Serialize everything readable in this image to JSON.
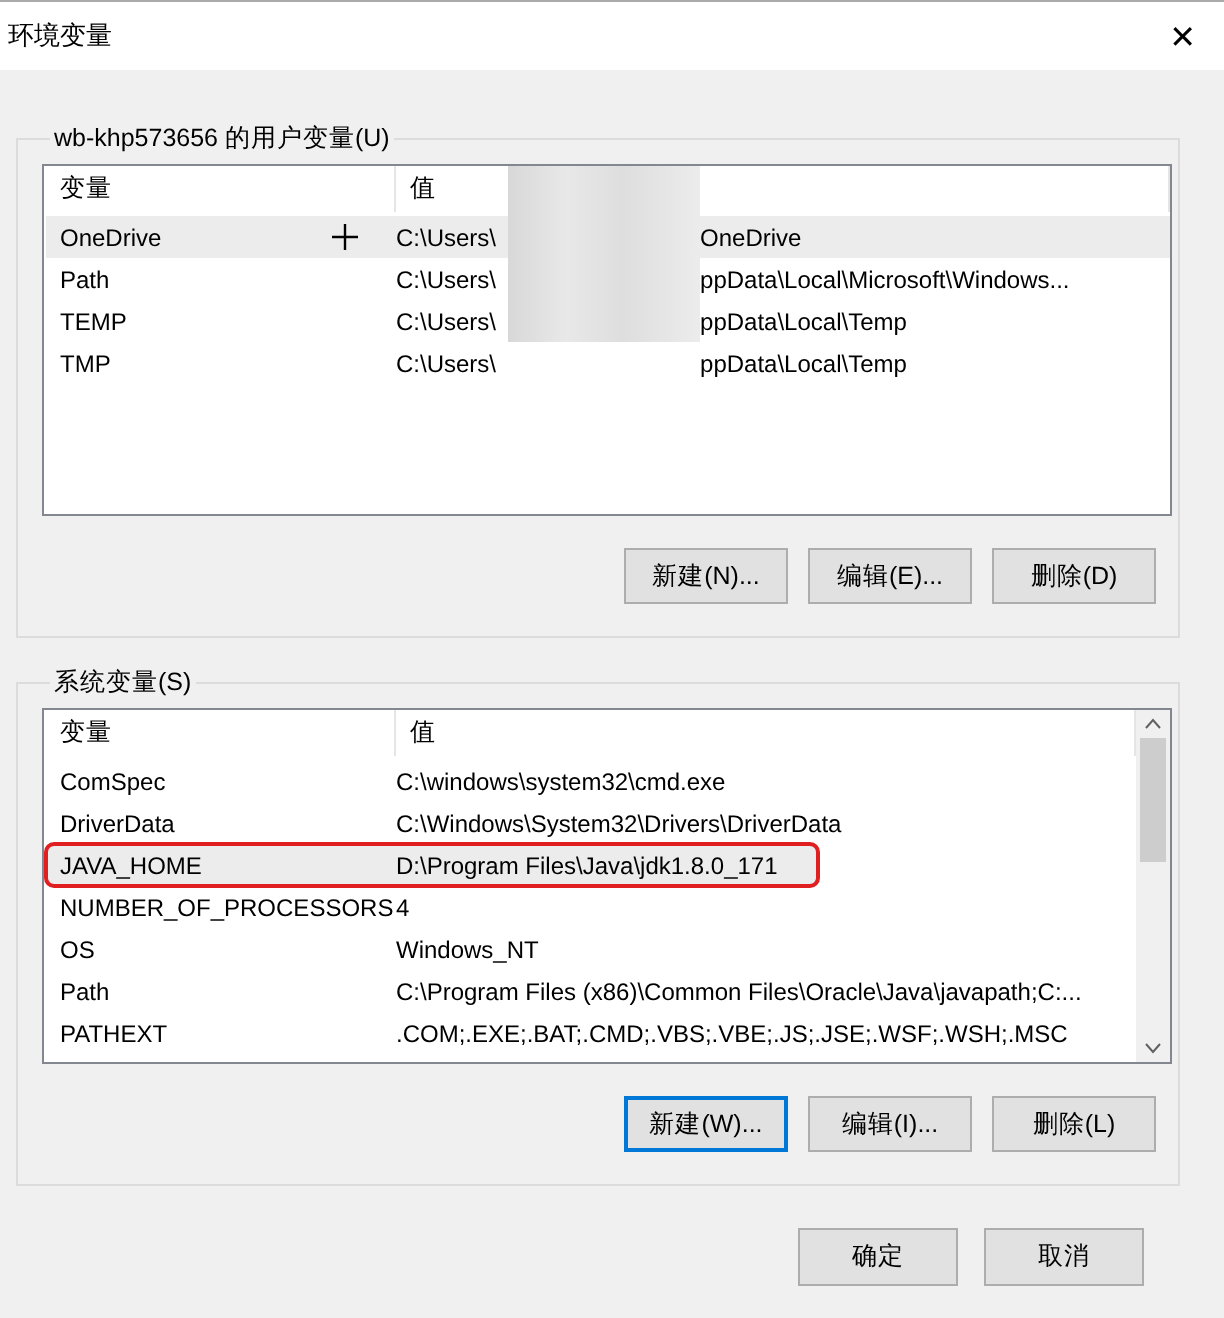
{
  "window": {
    "title": "环境变量",
    "close": "✕"
  },
  "user_vars": {
    "title": "wb-khp573656 的用户变量(U)",
    "columns": [
      "变量",
      "值"
    ],
    "rows": [
      {
        "name": "OneDrive",
        "value_start": "C:\\Users\\",
        "value_end": "OneDrive",
        "selected": true,
        "highlighted": false
      },
      {
        "name": "Path",
        "value_start": "C:\\Users\\",
        "value_end": "ppData\\Local\\Microsoft\\Windows...",
        "selected": false,
        "highlighted": false
      },
      {
        "name": "TEMP",
        "value_start": "C:\\Users\\",
        "value_end": "ppData\\Local\\Temp",
        "selected": false,
        "highlighted": false
      },
      {
        "name": "TMP",
        "value_start": "C:\\Users\\",
        "value_end": "ppData\\Local\\Temp",
        "selected": false,
        "highlighted": false
      }
    ],
    "buttons": [
      {
        "label": "新建(N)...",
        "default": false
      },
      {
        "label": "编辑(E)...",
        "default": false
      },
      {
        "label": "删除(D)",
        "default": false
      }
    ]
  },
  "system_vars": {
    "title": "系统变量(S)",
    "columns": [
      "变量",
      "值"
    ],
    "rows": [
      {
        "name": "ComSpec",
        "value_start": "C:\\windows\\system32\\cmd.exe",
        "selected": false,
        "highlighted": false
      },
      {
        "name": "DriverData",
        "value_start": "C:\\Windows\\System32\\Drivers\\DriverData",
        "selected": false,
        "highlighted": false
      },
      {
        "name": "JAVA_HOME",
        "value_start": "D:\\Program Files\\Java\\jdk1.8.0_171",
        "selected": true,
        "highlighted": true
      },
      {
        "name": "NUMBER_OF_PROCESSORS",
        "value_start": "4",
        "selected": false,
        "highlighted": false
      },
      {
        "name": "OS",
        "value_start": "Windows_NT",
        "selected": false,
        "highlighted": false
      },
      {
        "name": "Path",
        "value_start": "C:\\Program Files (x86)\\Common Files\\Oracle\\Java\\javapath;C:...",
        "selected": false,
        "highlighted": false
      },
      {
        "name": "PATHEXT",
        "value_start": ".COM;.EXE;.BAT;.CMD;.VBS;.VBE;.JS;.JSE;.WSF;.WSH;.MSC",
        "selected": false,
        "highlighted": false
      }
    ],
    "buttons": [
      {
        "label": "新建(W)...",
        "default": true
      },
      {
        "label": "编辑(I)...",
        "default": false
      },
      {
        "label": "删除(L)",
        "default": false
      }
    ]
  },
  "footer_buttons": [
    {
      "label": "确定",
      "default": false
    },
    {
      "label": "取消",
      "default": false
    }
  ]
}
